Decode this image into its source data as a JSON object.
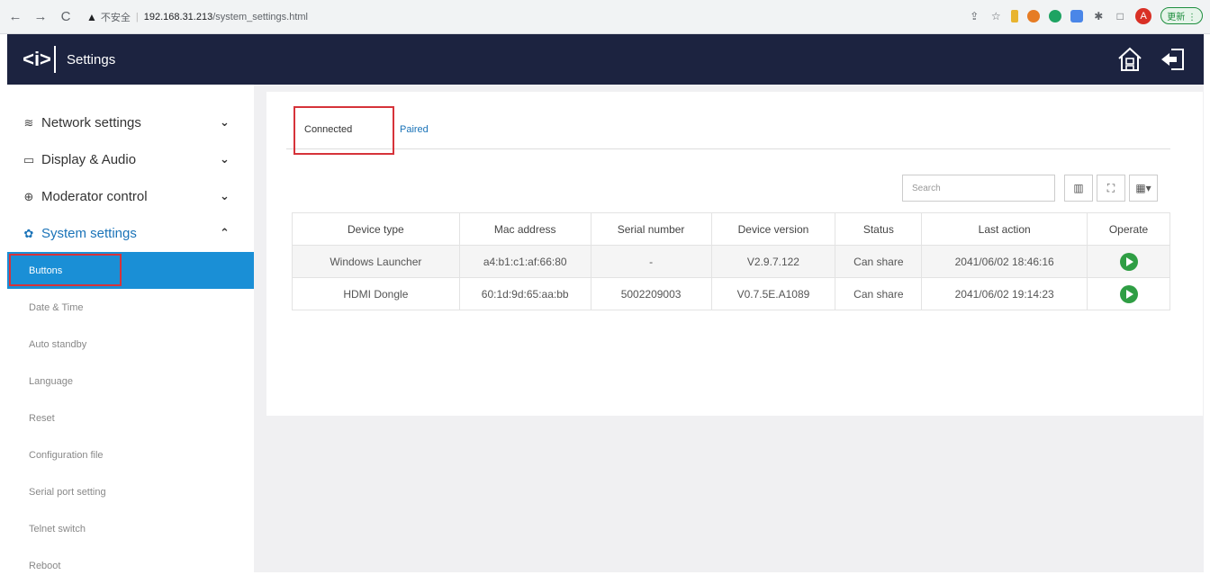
{
  "browser": {
    "back": "←",
    "forward": "→",
    "reload": "C",
    "insecure_label": "不安全",
    "url_host": "192.168.31.213",
    "url_path": "/system_settings.html",
    "avatar_letter": "A",
    "update_label": "更新 ⋮"
  },
  "header": {
    "logo": "<i>",
    "title": "Settings"
  },
  "sidebar": {
    "groups": [
      {
        "label": "Network settings",
        "icon": "wifi-icon",
        "chevron": "⌄"
      },
      {
        "label": "Display & Audio",
        "icon": "monitor-icon",
        "chevron": "⌄"
      },
      {
        "label": "Moderator control",
        "icon": "moderator-icon",
        "chevron": "⌄"
      },
      {
        "label": "System settings",
        "icon": "gear-icon",
        "chevron": "⌃"
      }
    ],
    "items": [
      {
        "label": "Buttons"
      },
      {
        "label": "Date & Time"
      },
      {
        "label": "Auto standby"
      },
      {
        "label": "Language"
      },
      {
        "label": "Reset"
      },
      {
        "label": "Configuration file"
      },
      {
        "label": "Serial port setting"
      },
      {
        "label": "Telnet switch"
      },
      {
        "label": "Reboot"
      }
    ]
  },
  "tabs": {
    "connected": "Connected",
    "paired": "Paired"
  },
  "toolbar": {
    "search_placeholder": "Search"
  },
  "table": {
    "headers": [
      "Device type",
      "Mac address",
      "Serial number",
      "Device version",
      "Status",
      "Last action",
      "Operate"
    ],
    "rows": [
      [
        "Windows Launcher",
        "a4:b1:c1:af:66:80",
        "-",
        "V2.9.7.122",
        "Can share",
        "2041/06/02 18:46:16"
      ],
      [
        "HDMI Dongle",
        "60:1d:9d:65:aa:bb",
        "5002209003",
        "V0.7.5E.A1089",
        "Can share",
        "2041/06/02 19:14:23"
      ]
    ]
  },
  "colors": {
    "header_bg": "#1c2340",
    "accent": "#1a8fd6",
    "highlight": "#d6333a",
    "play": "#2f9e44"
  }
}
